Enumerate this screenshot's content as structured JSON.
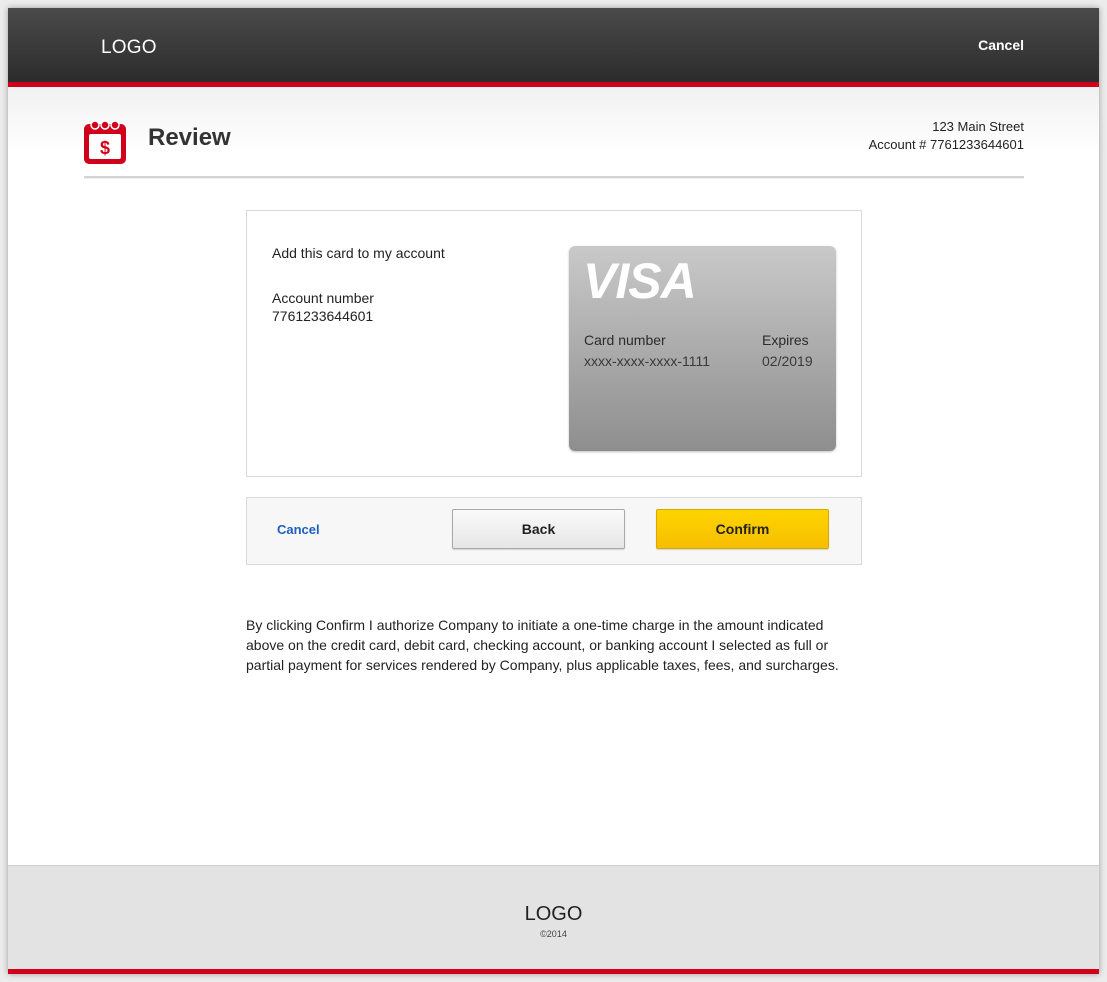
{
  "header": {
    "logo": "LOGO",
    "cancel_label": "Cancel"
  },
  "title_area": {
    "icon": "calendar-dollar-icon",
    "title": "Review",
    "address_line1": "123 Main Street",
    "address_line2": "Account # 7761233644601"
  },
  "card_panel": {
    "add_card_text": "Add this card to my account",
    "account_label": "Account number",
    "account_value": "7761233644601",
    "card": {
      "brand": "VISA",
      "number_label": "Card number",
      "number_value": "xxxx-xxxx-xxxx-1111",
      "expires_label": "Expires",
      "expires_value": "02/2019"
    }
  },
  "actions": {
    "cancel_label": "Cancel",
    "back_label": "Back",
    "confirm_label": "Confirm"
  },
  "disclaimer": "By clicking Confirm I authorize Company to initiate a one-time charge in the amount indicated above on the credit card, debit card, checking account, or banking account I selected as full or partial payment for services rendered by Company, plus applicable taxes, fees, and surcharges.",
  "footer": {
    "logo": "LOGO",
    "copyright": "©2014"
  },
  "colors": {
    "accent_red": "#d0021b",
    "confirm_yellow": "#ffd400",
    "link_blue": "#1f5fbf"
  }
}
